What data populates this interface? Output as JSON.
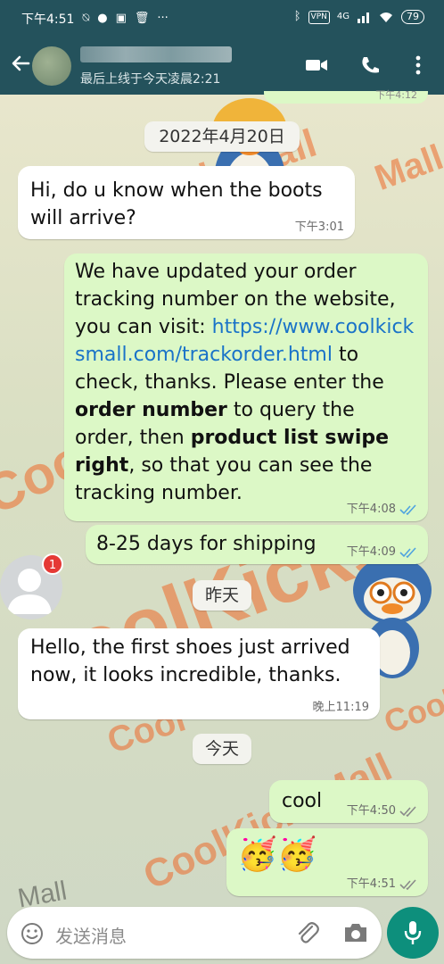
{
  "status_bar": {
    "time": "下午4:51",
    "vpn": "VPN",
    "network": "4G",
    "battery": "79",
    "more": "···"
  },
  "header": {
    "contact_status": "最后上线于今天凌晨2:21"
  },
  "top_message_time": "下午4:12",
  "messages": [
    {
      "type": "date",
      "text": "2022年4月20日"
    },
    {
      "type": "in",
      "text": "Hi, do u know when the boots will arrive?",
      "time": "下午3:01"
    },
    {
      "type": "out",
      "text_parts": {
        "p1": "We have updated your order tracking number on the website, you can visit: ",
        "link": "https://www.coolkicksmall.com/trackorder.html",
        "p2": " to check, thanks. Please enter the ",
        "bold1": "order number",
        "p3": " to query the order, then ",
        "bold2": "product list swipe right",
        "p4": ", so that you can see the tracking number."
      },
      "time": "下午4:08"
    },
    {
      "type": "out",
      "text": "8-25 days for shipping",
      "time": "下午4:09"
    },
    {
      "type": "date",
      "text": "昨天"
    },
    {
      "type": "in",
      "text": "Hello, the first shoes just arrived now, it looks incredible, thanks.",
      "time": "晚上11:19"
    },
    {
      "type": "date",
      "text": "今天"
    },
    {
      "type": "out",
      "text": "cool",
      "time": "下午4:50"
    },
    {
      "type": "out",
      "text": "🥳🥳",
      "time": "下午4:51"
    }
  ],
  "unread_count": "1",
  "composer": {
    "placeholder": "发送消息"
  },
  "wallpaper_text": [
    "CoolKicksMall",
    "CoolKicksMall",
    "Mall",
    "CoolKicks",
    "Mall",
    "Cool",
    "Cool",
    "Cool"
  ],
  "colors": {
    "header_bg": "#24525c",
    "outgoing_bubble": "#dcf8c6",
    "incoming_bubble": "#ffffff",
    "link": "#1a73c8",
    "read_ticks": "#4fa3e0",
    "mic_button": "#0d8f7c",
    "watermark": "#ee6a2a"
  },
  "icons": [
    "back-arrow-icon",
    "video-call-icon",
    "phone-icon",
    "more-vert-icon",
    "emoji-icon",
    "attach-icon",
    "camera-icon",
    "mic-icon",
    "read-ticks-icon",
    "sent-ticks-icon"
  ]
}
